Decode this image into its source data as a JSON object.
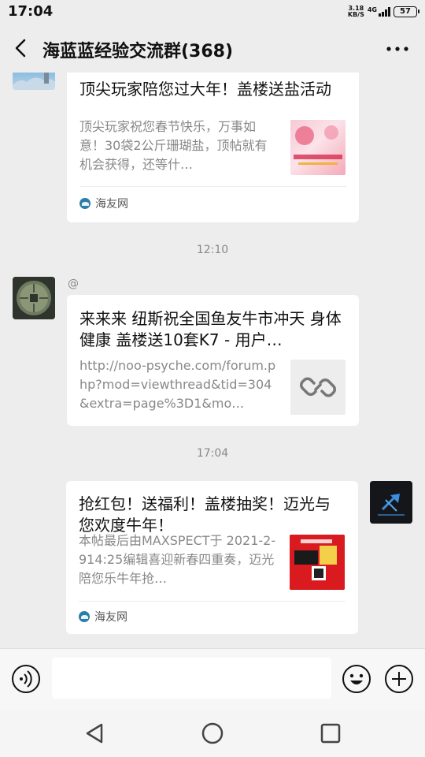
{
  "status_bar": {
    "time": "17:04",
    "speed_value": "3.18",
    "speed_unit": "KB/S",
    "network": "4G",
    "battery": "57"
  },
  "header": {
    "title": "海蓝蓝经验交流群(368)",
    "back_icon": "back-arrow-icon",
    "more_icon": "more-dots-icon"
  },
  "messages": [
    {
      "type": "link_card",
      "side": "left",
      "title": "顶尖玩家陪您过大年！盖楼送盐活动",
      "description": "顶尖玩家祝您春节快乐，万事如意！30袋2公斤珊瑚盐，顶帖就有机会获得，还等什…",
      "source": "海友网"
    },
    {
      "type": "timestamp",
      "text": "12:10"
    },
    {
      "type": "link_card",
      "side": "left",
      "sender": "@",
      "title": "来来来 纽斯祝全国鱼友牛市冲天 身体健康 盖楼送10套K7 - 用户…",
      "description": "http://noo-psyche.com/forum.php?mod=viewthread&tid=304&extra=page%3D1&mo…",
      "thumb_icon": "link-icon"
    },
    {
      "type": "timestamp",
      "text": "17:04"
    },
    {
      "type": "link_card",
      "side": "right",
      "title": "抢红包！送福利！盖楼抽奖！迈光与您欢度牛年！",
      "description": "本帖最后由MAXSPECT于 2021-2-914:25编辑喜迎新春四重奏，迈光陪您乐牛年抢…",
      "source": "海友网"
    }
  ],
  "input_bar": {
    "voice_icon": "voice-icon",
    "emoji_icon": "emoji-icon",
    "plus_icon": "plus-icon",
    "text": ""
  },
  "system_nav": {
    "back_icon": "nav-back-icon",
    "home_icon": "nav-home-icon",
    "recents_icon": "nav-recents-icon"
  },
  "colors": {
    "background": "#ededed",
    "card": "#ffffff",
    "text_primary": "#111111",
    "text_secondary": "#888888"
  }
}
